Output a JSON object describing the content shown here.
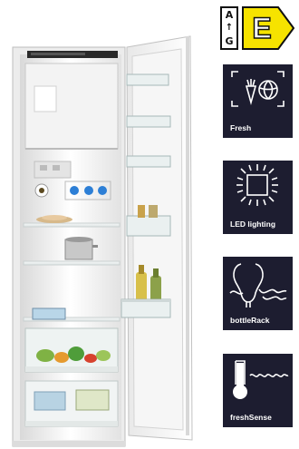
{
  "energy_label": {
    "scale_top": "A",
    "scale_bottom": "G",
    "class": "E",
    "class_color": "#f6e300"
  },
  "features": [
    {
      "label": "Fresh",
      "icon": "fresh-vegetables-icon"
    },
    {
      "label": "LED lighting",
      "icon": "led-light-icon"
    },
    {
      "label": "bottleRack",
      "icon": "bottle-rack-icon"
    },
    {
      "label": "freshSense",
      "icon": "thermometer-icon"
    }
  ],
  "colors": {
    "tile_background": "#1d1d30",
    "icon_color": "#ffffff"
  }
}
